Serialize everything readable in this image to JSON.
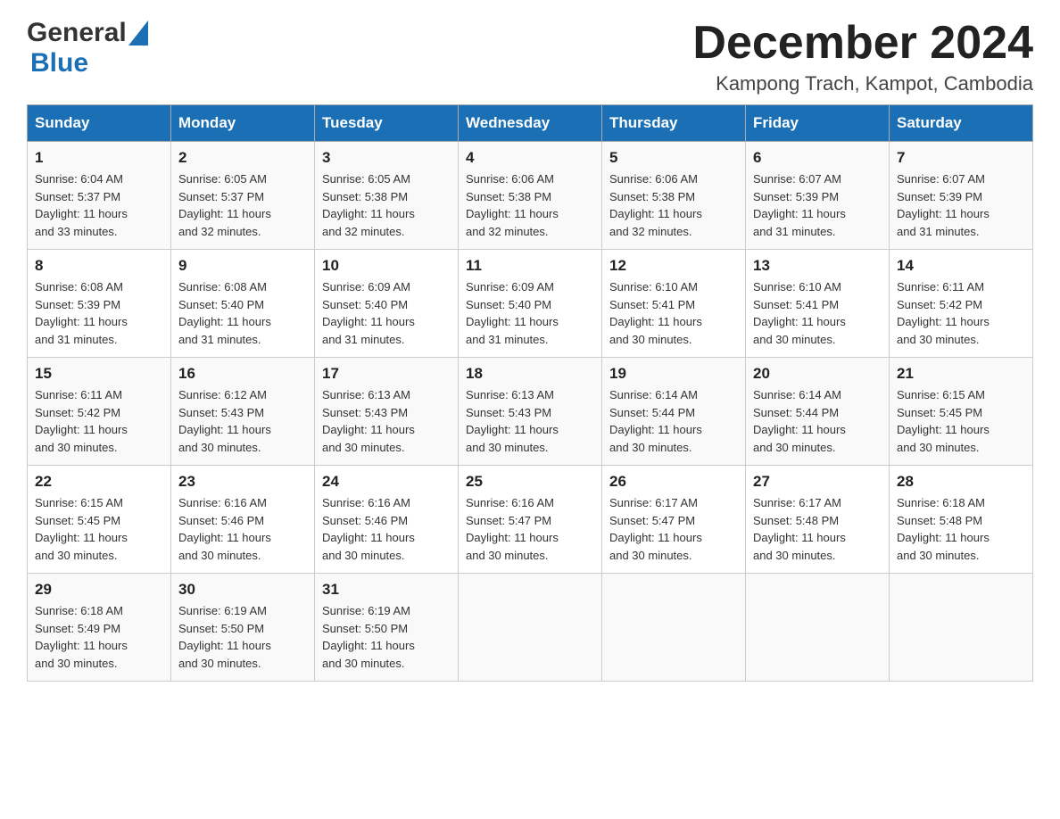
{
  "header": {
    "logo_general": "General",
    "logo_blue": "Blue",
    "month_title": "December 2024",
    "location": "Kampong Trach, Kampot, Cambodia"
  },
  "weekdays": [
    "Sunday",
    "Monday",
    "Tuesday",
    "Wednesday",
    "Thursday",
    "Friday",
    "Saturday"
  ],
  "weeks": [
    [
      {
        "day": "1",
        "sunrise": "6:04 AM",
        "sunset": "5:37 PM",
        "daylight": "11 hours and 33 minutes."
      },
      {
        "day": "2",
        "sunrise": "6:05 AM",
        "sunset": "5:37 PM",
        "daylight": "11 hours and 32 minutes."
      },
      {
        "day": "3",
        "sunrise": "6:05 AM",
        "sunset": "5:38 PM",
        "daylight": "11 hours and 32 minutes."
      },
      {
        "day": "4",
        "sunrise": "6:06 AM",
        "sunset": "5:38 PM",
        "daylight": "11 hours and 32 minutes."
      },
      {
        "day": "5",
        "sunrise": "6:06 AM",
        "sunset": "5:38 PM",
        "daylight": "11 hours and 32 minutes."
      },
      {
        "day": "6",
        "sunrise": "6:07 AM",
        "sunset": "5:39 PM",
        "daylight": "11 hours and 31 minutes."
      },
      {
        "day": "7",
        "sunrise": "6:07 AM",
        "sunset": "5:39 PM",
        "daylight": "11 hours and 31 minutes."
      }
    ],
    [
      {
        "day": "8",
        "sunrise": "6:08 AM",
        "sunset": "5:39 PM",
        "daylight": "11 hours and 31 minutes."
      },
      {
        "day": "9",
        "sunrise": "6:08 AM",
        "sunset": "5:40 PM",
        "daylight": "11 hours and 31 minutes."
      },
      {
        "day": "10",
        "sunrise": "6:09 AM",
        "sunset": "5:40 PM",
        "daylight": "11 hours and 31 minutes."
      },
      {
        "day": "11",
        "sunrise": "6:09 AM",
        "sunset": "5:40 PM",
        "daylight": "11 hours and 31 minutes."
      },
      {
        "day": "12",
        "sunrise": "6:10 AM",
        "sunset": "5:41 PM",
        "daylight": "11 hours and 30 minutes."
      },
      {
        "day": "13",
        "sunrise": "6:10 AM",
        "sunset": "5:41 PM",
        "daylight": "11 hours and 30 minutes."
      },
      {
        "day": "14",
        "sunrise": "6:11 AM",
        "sunset": "5:42 PM",
        "daylight": "11 hours and 30 minutes."
      }
    ],
    [
      {
        "day": "15",
        "sunrise": "6:11 AM",
        "sunset": "5:42 PM",
        "daylight": "11 hours and 30 minutes."
      },
      {
        "day": "16",
        "sunrise": "6:12 AM",
        "sunset": "5:43 PM",
        "daylight": "11 hours and 30 minutes."
      },
      {
        "day": "17",
        "sunrise": "6:13 AM",
        "sunset": "5:43 PM",
        "daylight": "11 hours and 30 minutes."
      },
      {
        "day": "18",
        "sunrise": "6:13 AM",
        "sunset": "5:43 PM",
        "daylight": "11 hours and 30 minutes."
      },
      {
        "day": "19",
        "sunrise": "6:14 AM",
        "sunset": "5:44 PM",
        "daylight": "11 hours and 30 minutes."
      },
      {
        "day": "20",
        "sunrise": "6:14 AM",
        "sunset": "5:44 PM",
        "daylight": "11 hours and 30 minutes."
      },
      {
        "day": "21",
        "sunrise": "6:15 AM",
        "sunset": "5:45 PM",
        "daylight": "11 hours and 30 minutes."
      }
    ],
    [
      {
        "day": "22",
        "sunrise": "6:15 AM",
        "sunset": "5:45 PM",
        "daylight": "11 hours and 30 minutes."
      },
      {
        "day": "23",
        "sunrise": "6:16 AM",
        "sunset": "5:46 PM",
        "daylight": "11 hours and 30 minutes."
      },
      {
        "day": "24",
        "sunrise": "6:16 AM",
        "sunset": "5:46 PM",
        "daylight": "11 hours and 30 minutes."
      },
      {
        "day": "25",
        "sunrise": "6:16 AM",
        "sunset": "5:47 PM",
        "daylight": "11 hours and 30 minutes."
      },
      {
        "day": "26",
        "sunrise": "6:17 AM",
        "sunset": "5:47 PM",
        "daylight": "11 hours and 30 minutes."
      },
      {
        "day": "27",
        "sunrise": "6:17 AM",
        "sunset": "5:48 PM",
        "daylight": "11 hours and 30 minutes."
      },
      {
        "day": "28",
        "sunrise": "6:18 AM",
        "sunset": "5:48 PM",
        "daylight": "11 hours and 30 minutes."
      }
    ],
    [
      {
        "day": "29",
        "sunrise": "6:18 AM",
        "sunset": "5:49 PM",
        "daylight": "11 hours and 30 minutes."
      },
      {
        "day": "30",
        "sunrise": "6:19 AM",
        "sunset": "5:50 PM",
        "daylight": "11 hours and 30 minutes."
      },
      {
        "day": "31",
        "sunrise": "6:19 AM",
        "sunset": "5:50 PM",
        "daylight": "11 hours and 30 minutes."
      },
      null,
      null,
      null,
      null
    ]
  ],
  "labels": {
    "sunrise": "Sunrise:",
    "sunset": "Sunset:",
    "daylight": "Daylight:"
  }
}
